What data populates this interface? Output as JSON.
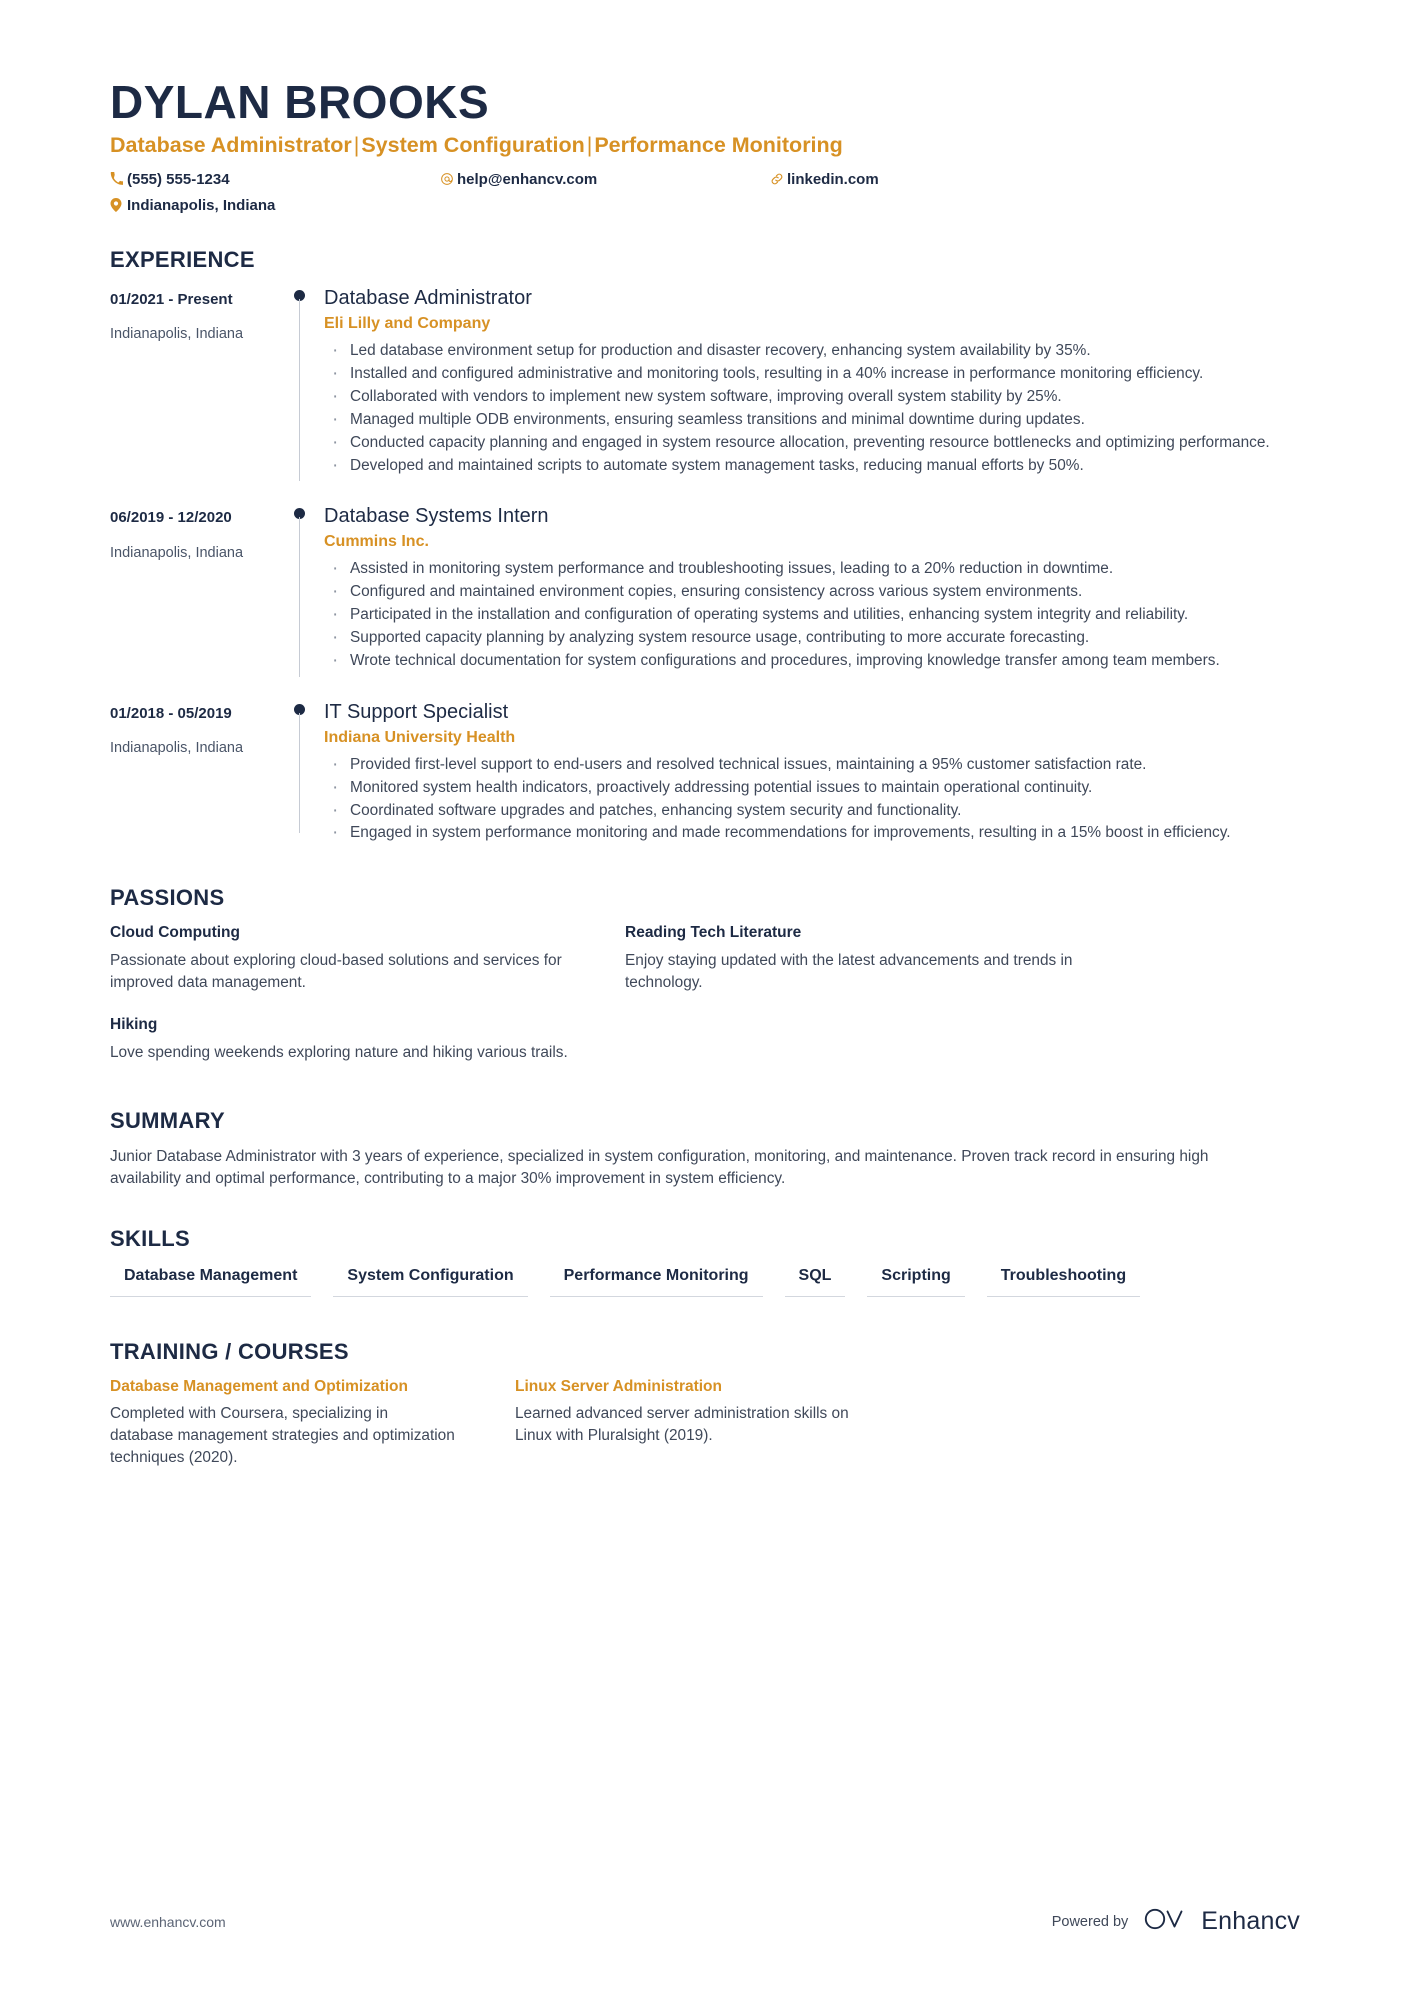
{
  "header": {
    "name": "DYLAN BROOKS",
    "headline_parts": [
      "Database Administrator",
      "System Configuration",
      "Performance Monitoring"
    ],
    "separator": "|",
    "contacts": [
      {
        "icon": "phone-icon",
        "value": "(555) 555-1234"
      },
      {
        "icon": "email-icon",
        "value": "help@enhancv.com"
      },
      {
        "icon": "link-icon",
        "value": "linkedin.com"
      },
      {
        "icon": "location-pin-icon",
        "value": "Indianapolis, Indiana"
      }
    ]
  },
  "sections": {
    "experience_title": "EXPERIENCE",
    "passions_title": "PASSIONS",
    "summary_title": "SUMMARY",
    "skills_title": "SKILLS",
    "training_title": "TRAINING / COURSES"
  },
  "experience": [
    {
      "date": "01/2021 - Present",
      "location": "Indianapolis, Indiana",
      "role": "Database Administrator",
      "company": "Eli Lilly and Company",
      "bullets": [
        "Led database environment setup for production and disaster recovery, enhancing system availability by 35%.",
        "Installed and configured administrative and monitoring tools, resulting in a 40% increase in performance monitoring efficiency.",
        "Collaborated with vendors to implement new system software, improving overall system stability by 25%.",
        "Managed multiple ODB environments, ensuring seamless transitions and minimal downtime during updates.",
        "Conducted capacity planning and engaged in system resource allocation, preventing resource bottlenecks and optimizing performance.",
        "Developed and maintained scripts to automate system management tasks, reducing manual efforts by 50%."
      ]
    },
    {
      "date": "06/2019 - 12/2020",
      "location": "Indianapolis, Indiana",
      "role": "Database Systems Intern",
      "company": "Cummins Inc.",
      "bullets": [
        "Assisted in monitoring system performance and troubleshooting issues, leading to a 20% reduction in downtime.",
        "Configured and maintained environment copies, ensuring consistency across various system environments.",
        "Participated in the installation and configuration of operating systems and utilities, enhancing system integrity and reliability.",
        "Supported capacity planning by analyzing system resource usage, contributing to more accurate forecasting.",
        "Wrote technical documentation for system configurations and procedures, improving knowledge transfer among team members."
      ]
    },
    {
      "date": "01/2018 - 05/2019",
      "location": "Indianapolis, Indiana",
      "role": "IT Support Specialist",
      "company": "Indiana University Health",
      "bullets": [
        "Provided first-level support to end-users and resolved technical issues, maintaining a 95% customer satisfaction rate.",
        "Monitored system health indicators, proactively addressing potential issues to maintain operational continuity.",
        "Coordinated software upgrades and patches, enhancing system security and functionality.",
        "Engaged in system performance monitoring and made recommendations for improvements, resulting in a 15% boost in efficiency."
      ]
    }
  ],
  "passions": [
    {
      "title": "Cloud Computing",
      "text": "Passionate about exploring cloud-based solutions and services for improved data management."
    },
    {
      "title": "Reading Tech Literature",
      "text": "Enjoy staying updated with the latest advancements and trends in technology."
    },
    {
      "title": "Hiking",
      "text": "Love spending weekends exploring nature and hiking various trails."
    }
  ],
  "summary": "Junior Database Administrator with 3 years of experience, specialized in system configuration, monitoring, and maintenance. Proven track record in ensuring high availability and optimal performance, contributing to a major 30% improvement in system efficiency.",
  "skills": [
    "Database Management",
    "System Configuration",
    "Performance Monitoring",
    "SQL",
    "Scripting",
    "Troubleshooting"
  ],
  "training": [
    {
      "title": "Database Management and Optimization",
      "text": "Completed with Coursera, specializing in database management strategies and optimization techniques (2020)."
    },
    {
      "title": "Linux Server Administration",
      "text": "Learned advanced server administration skills on Linux with Pluralsight (2019)."
    }
  ],
  "footer": {
    "url": "www.enhancv.com",
    "powered_by": "Powered by",
    "brand": "Enhancv"
  },
  "colors": {
    "navy": "#1d2a44",
    "accent": "#d79124",
    "body_text": "#3f4859"
  }
}
